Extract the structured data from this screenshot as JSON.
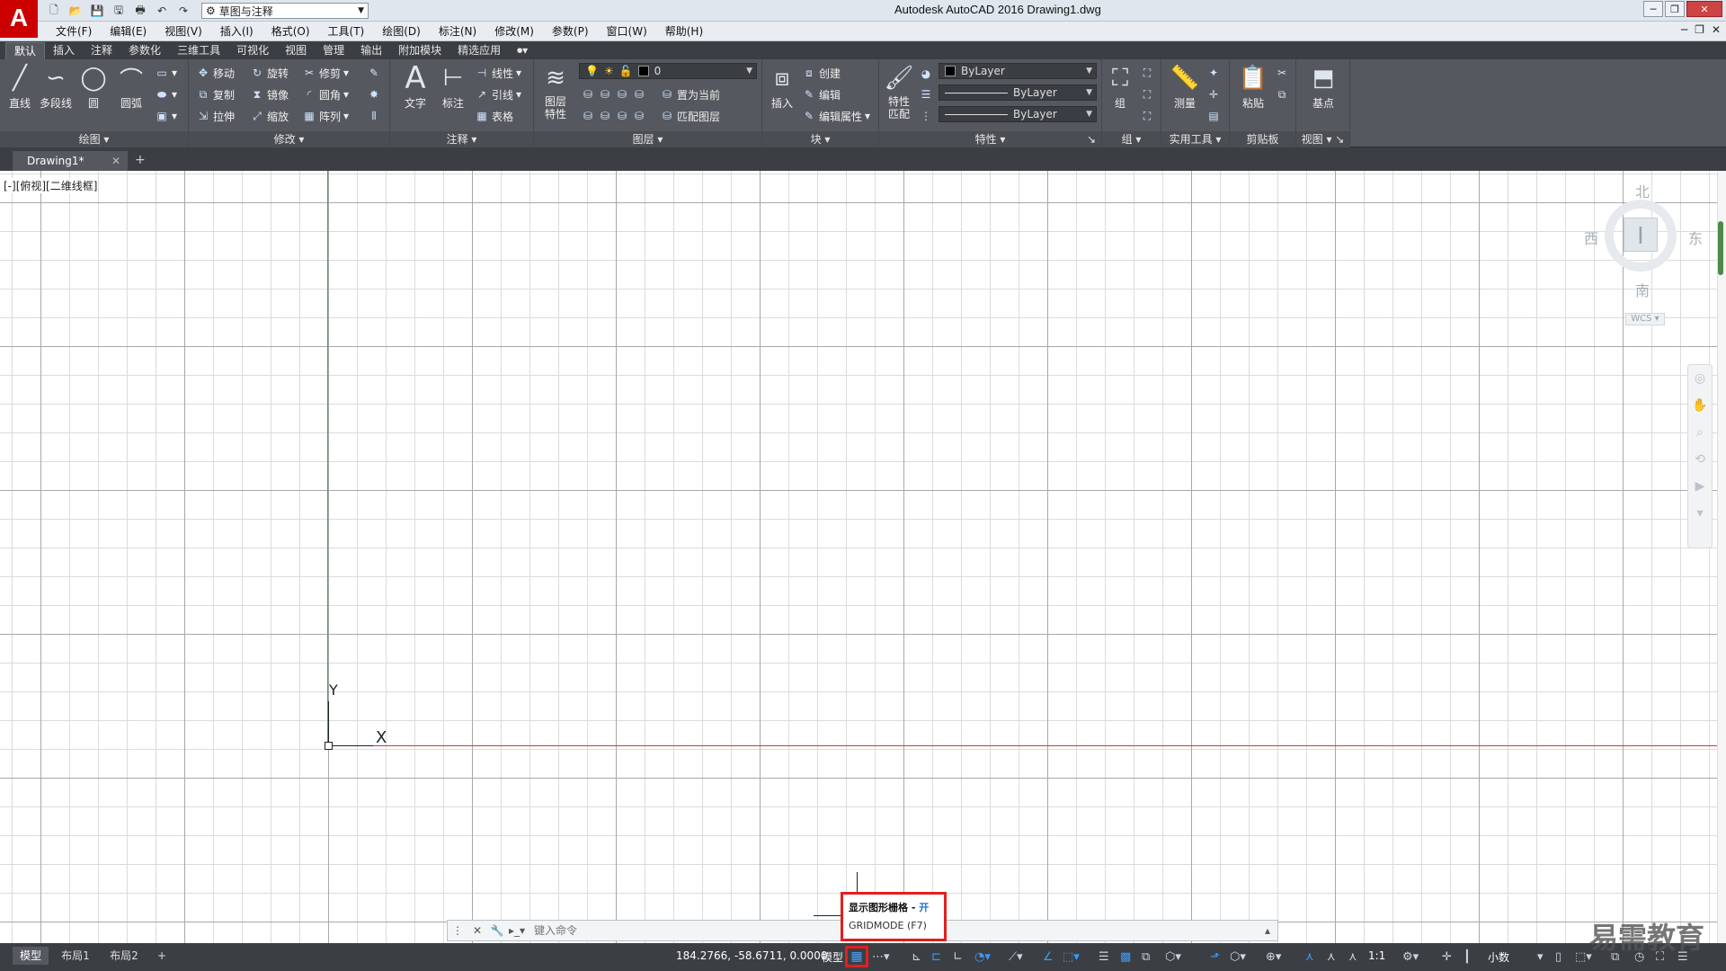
{
  "app": {
    "logo": "A",
    "title": "Autodesk AutoCAD 2016    Drawing1.dwg",
    "workspace": "草图与注释"
  },
  "quick_access": [
    "new-icon",
    "open-icon",
    "save-icon",
    "saveas-icon",
    "print-icon",
    "undo-icon",
    "redo-icon"
  ],
  "menu": [
    "文件(F)",
    "编辑(E)",
    "视图(V)",
    "插入(I)",
    "格式(O)",
    "工具(T)",
    "绘图(D)",
    "标注(N)",
    "修改(M)",
    "参数(P)",
    "窗口(W)",
    "帮助(H)"
  ],
  "ribbon_tabs": [
    "默认",
    "插入",
    "注释",
    "参数化",
    "三维工具",
    "可视化",
    "视图",
    "管理",
    "输出",
    "附加模块",
    "精选应用"
  ],
  "panels": {
    "draw": {
      "title": "绘图",
      "tools": [
        "直线",
        "多段线",
        "圆",
        "圆弧"
      ]
    },
    "modify": {
      "title": "修改",
      "tools": [
        "移动",
        "旋转",
        "修剪",
        "复制",
        "镜像",
        "圆角",
        "拉伸",
        "缩放",
        "阵列"
      ]
    },
    "annotation": {
      "title": "注释",
      "tools": [
        "文字",
        "标注",
        "线性",
        "引线",
        "表格"
      ]
    },
    "layers": {
      "title": "图层",
      "props_label": "图层特性",
      "layer_value": "0",
      "set_current": "置为当前",
      "match_layer": "匹配图层"
    },
    "block": {
      "title": "块",
      "insert": "插入",
      "create": "创建",
      "edit": "编辑",
      "edit_attr": "编辑属性"
    },
    "properties": {
      "title": "特性",
      "match": "特性匹配",
      "color": "ByLayer",
      "linetype": "ByLayer",
      "lineweight": "ByLayer"
    },
    "groups": {
      "title": "组",
      "group": "组"
    },
    "utilities": {
      "title": "实用工具",
      "measure": "测量"
    },
    "clipboard": {
      "title": "剪贴板",
      "paste": "粘贴"
    },
    "view": {
      "title": "视图",
      "base": "基点"
    }
  },
  "doc_tab": "Drawing1*",
  "viewport_label": "[-][俯视][二维线框]",
  "ucs": {
    "x": "X",
    "y": "Y"
  },
  "viewcube": {
    "north": "北",
    "south": "南",
    "east": "东",
    "west": "西",
    "wcs": "WCS"
  },
  "command": {
    "placeholder": "键入命令"
  },
  "tooltip": {
    "title": "显示图形栅格 - ",
    "state": "开",
    "shortcut": "GRIDMODE (F7)"
  },
  "status": {
    "layouts": [
      "模型",
      "布局1",
      "布局2"
    ],
    "coords": "184.2766, -58.6711, 0.0000",
    "model": "模型",
    "scale": "1:1",
    "units": "小数"
  },
  "watermark": "易需教育",
  "colors": {
    "accent": "#e02020",
    "ribbon": "#55595f",
    "x_axis": "#dd3333",
    "y_axis": "#3ab03a"
  }
}
